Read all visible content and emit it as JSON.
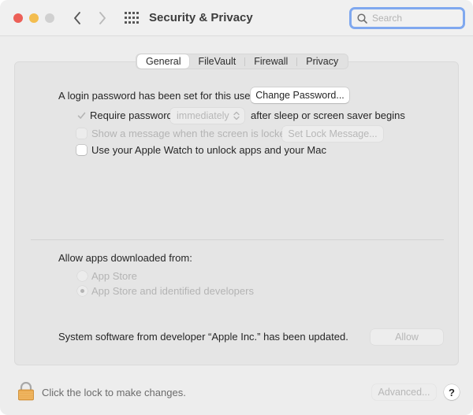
{
  "window": {
    "title": "Security & Privacy",
    "traffic_lights": {
      "close": "#ec5f57",
      "minimize": "#f3bd4f",
      "maximize": "#d0d0d0"
    },
    "nav": {
      "back_icon": "chevron-left-icon",
      "forward_icon": "chevron-right-icon",
      "grid_icon": "show-all-grid-icon"
    }
  },
  "search": {
    "placeholder": "Search",
    "value": "",
    "focus_ring_color": "#7fa8ef"
  },
  "tabs": [
    {
      "label": "General",
      "active": true
    },
    {
      "label": "FileVault",
      "active": false
    },
    {
      "label": "Firewall",
      "active": false
    },
    {
      "label": "Privacy",
      "active": false
    }
  ],
  "general": {
    "login_password_text": "A login password has been set for this user",
    "change_password_button": "Change Password...",
    "require_password": {
      "label": "Require password",
      "checked": true,
      "enabled": false,
      "delay_value": "immediately",
      "suffix": "after sleep or screen saver begins"
    },
    "show_message": {
      "label": "Show a message when the screen is locked",
      "checked": false,
      "enabled": false,
      "button": "Set Lock Message..."
    },
    "apple_watch": {
      "label": "Use your Apple Watch to unlock apps and your Mac",
      "checked": false,
      "enabled": true
    },
    "allow_apps": {
      "heading": "Allow apps downloaded from:",
      "options": [
        {
          "label": "App Store",
          "selected": false
        },
        {
          "label": "App Store and identified developers",
          "selected": true
        }
      ]
    },
    "system_software": {
      "text": "System software from developer “Apple Inc.” has been updated.",
      "allow_button": "Allow"
    }
  },
  "footer": {
    "lock_text": "Click the lock to make changes.",
    "advanced_button": "Advanced...",
    "help_button": "?",
    "lock_icon": "padlock-icon"
  }
}
